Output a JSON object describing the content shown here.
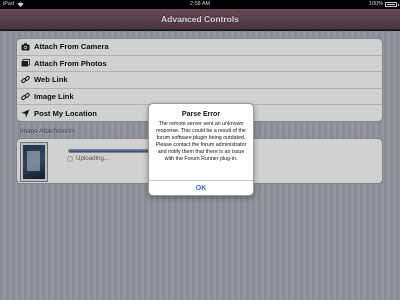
{
  "status_bar": {
    "carrier": "iPad",
    "time": "2:58 AM",
    "battery_pct": "100%"
  },
  "nav": {
    "title": "Advanced Controls"
  },
  "options": [
    {
      "label": "Attach From Camera",
      "icon": "camera-icon"
    },
    {
      "label": "Attach From Photos",
      "icon": "photos-icon"
    },
    {
      "label": "Web Link",
      "icon": "link-icon"
    },
    {
      "label": "Image Link",
      "icon": "link-icon"
    },
    {
      "label": "Post My Location",
      "icon": "location-icon"
    }
  ],
  "attachments": {
    "header": "Image Attachments",
    "upload_status": "Uploading...",
    "progress": 0.95
  },
  "alert": {
    "title": "Parse Error",
    "message": "The remote server sent an unknown response.  This could be a result of the forum software plugin being outdated.  Please contact the forum administrator and notify them that there is an issue with the Forum Runner plug-in.",
    "ok_label": "OK"
  },
  "colors": {
    "nav_bar": "#6b4c5e",
    "alert_button": "#2a6fd6"
  }
}
